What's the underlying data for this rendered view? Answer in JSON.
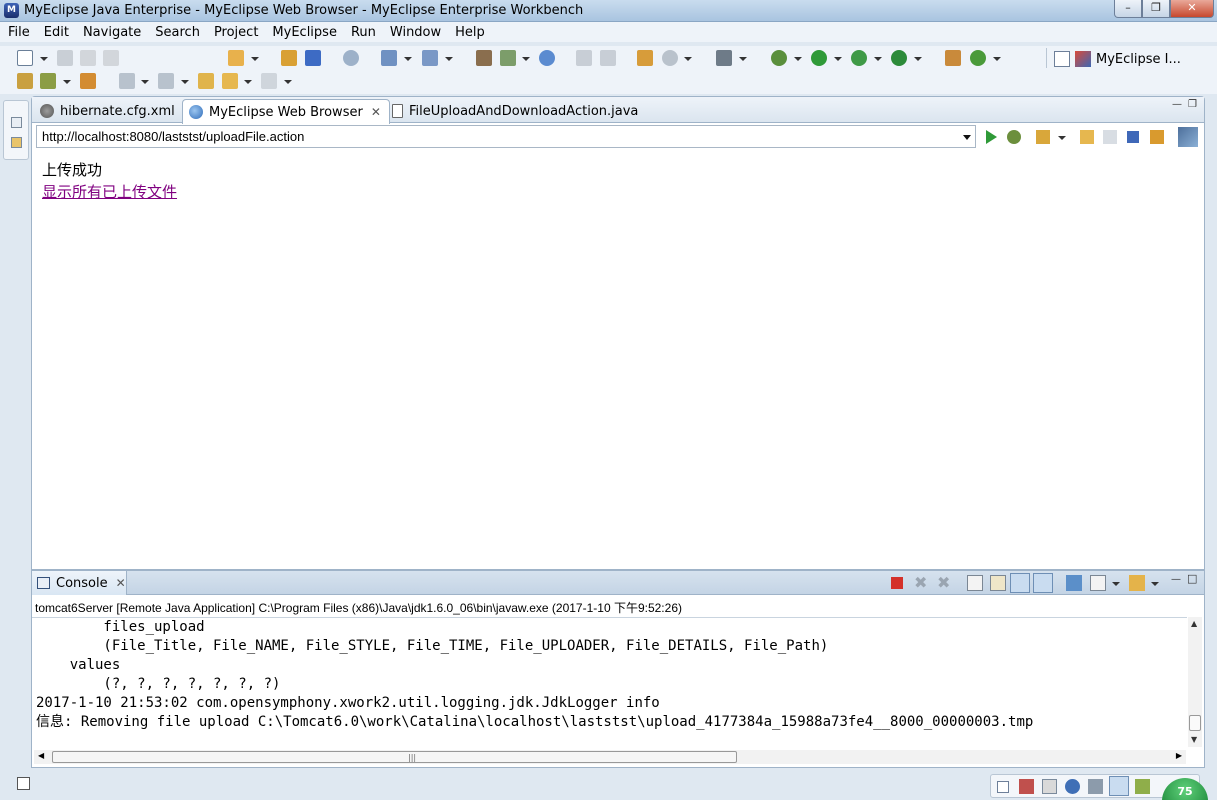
{
  "window": {
    "title": "MyEclipse Java Enterprise - MyEclipse Web Browser - MyEclipse Enterprise Workbench"
  },
  "menu": [
    "File",
    "Edit",
    "Navigate",
    "Search",
    "Project",
    "MyEclipse",
    "Run",
    "Window",
    "Help"
  ],
  "perspective": {
    "label": "MyEclipse I..."
  },
  "editor_tabs": [
    {
      "label": "hibernate.cfg.xml"
    },
    {
      "label": "MyEclipse Web Browser"
    },
    {
      "label": "FileUploadAndDownloadAction.java"
    }
  ],
  "browser": {
    "url": "http://localhost:8080/laststst/uploadFile.action",
    "message": "上传成功",
    "link": "显示所有已上传文件"
  },
  "console": {
    "tab_label": "Console",
    "description": "tomcat6Server [Remote Java Application] C:\\Program Files (x86)\\Java\\jdk1.6.0_06\\bin\\javaw.exe (2017-1-10 下午9:52:26)",
    "lines": [
      "        files_upload",
      "        (File_Title, File_NAME, File_STYLE, File_TIME, File_UPLOADER, File_DETAILS, File_Path)",
      "    values",
      "        (?, ?, ?, ?, ?, ?, ?)",
      "2017-1-10 21:53:02 com.opensymphony.xwork2.util.logging.jdk.JdkLogger info",
      "信息: Removing file upload C:\\Tomcat6.0\\work\\Catalina\\localhost\\laststst\\upload_4177384a_15988a73fe4__8000_00000003.tmp"
    ]
  },
  "status": {
    "badge": "75"
  },
  "colors": {
    "link_visited": "#800080",
    "titlebar": "#b9d0e8",
    "close_button": "#c7482d"
  }
}
